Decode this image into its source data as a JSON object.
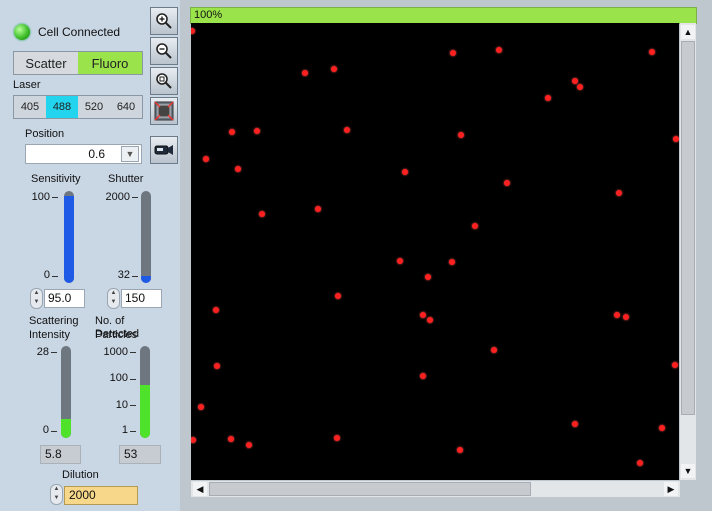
{
  "status": {
    "label": "Cell Connected",
    "color": "#3fbf2a"
  },
  "mode_tabs": [
    {
      "label": "Scatter",
      "selected": false
    },
    {
      "label": "Fluoro",
      "selected": true
    }
  ],
  "laser": {
    "label": "Laser",
    "options": [
      {
        "label": "405",
        "selected": false
      },
      {
        "label": "488",
        "selected": true
      },
      {
        "label": "520",
        "selected": false
      },
      {
        "label": "640",
        "selected": false
      }
    ]
  },
  "position": {
    "label": "Position",
    "value": "0.6"
  },
  "sensitivity": {
    "label": "Sensitivity",
    "tick_max": "100",
    "tick_min": "0",
    "value": "95.0",
    "level": 0.95
  },
  "shutter": {
    "label": "Shutter",
    "tick_max": "2000",
    "tick_min": "32",
    "value": "150",
    "level": 0.08
  },
  "scattering": {
    "label_line1": "Scattering",
    "label_line2": "Intensity",
    "tick_max": "28",
    "tick_min": "0",
    "value": "5.8",
    "level": 0.21
  },
  "detected": {
    "label_line1": "No. of Detected",
    "label_line2": "Particles",
    "ticks": [
      "1000",
      "100",
      "10",
      "1"
    ],
    "value": "53",
    "level": 0.58
  },
  "dilution": {
    "label": "Dilution",
    "value": "2000"
  },
  "tools": [
    "zoom-in-icon",
    "zoom-out-icon",
    "zoom-fit-icon",
    "fit-window-icon",
    "camera-icon"
  ],
  "viewer": {
    "progress_label": "100%",
    "progress_value": 1.0
  },
  "particles": [
    [
      0.003,
      0.017
    ],
    [
      0.234,
      0.109
    ],
    [
      0.293,
      0.101
    ],
    [
      0.536,
      0.066
    ],
    [
      0.631,
      0.06
    ],
    [
      0.787,
      0.127
    ],
    [
      0.797,
      0.14
    ],
    [
      0.731,
      0.164
    ],
    [
      0.945,
      0.063
    ],
    [
      0.084,
      0.239
    ],
    [
      0.135,
      0.236
    ],
    [
      0.319,
      0.235
    ],
    [
      0.553,
      0.246
    ],
    [
      0.993,
      0.253
    ],
    [
      0.03,
      0.297
    ],
    [
      0.097,
      0.32
    ],
    [
      0.438,
      0.325
    ],
    [
      0.648,
      0.351
    ],
    [
      0.878,
      0.372
    ],
    [
      0.261,
      0.406
    ],
    [
      0.146,
      0.417
    ],
    [
      0.581,
      0.445
    ],
    [
      0.428,
      0.521
    ],
    [
      0.535,
      0.524
    ],
    [
      0.486,
      0.556
    ],
    [
      0.301,
      0.597
    ],
    [
      0.052,
      0.627
    ],
    [
      0.475,
      0.64
    ],
    [
      0.872,
      0.639
    ],
    [
      0.49,
      0.649
    ],
    [
      0.892,
      0.644
    ],
    [
      0.62,
      0.716
    ],
    [
      0.053,
      0.75
    ],
    [
      0.476,
      0.773
    ],
    [
      0.991,
      0.748
    ],
    [
      0.021,
      0.84
    ],
    [
      0.786,
      0.877
    ],
    [
      0.965,
      0.886
    ],
    [
      0.005,
      0.913
    ],
    [
      0.081,
      0.911
    ],
    [
      0.118,
      0.924
    ],
    [
      0.299,
      0.908
    ],
    [
      0.552,
      0.934
    ],
    [
      0.921,
      0.963
    ]
  ]
}
